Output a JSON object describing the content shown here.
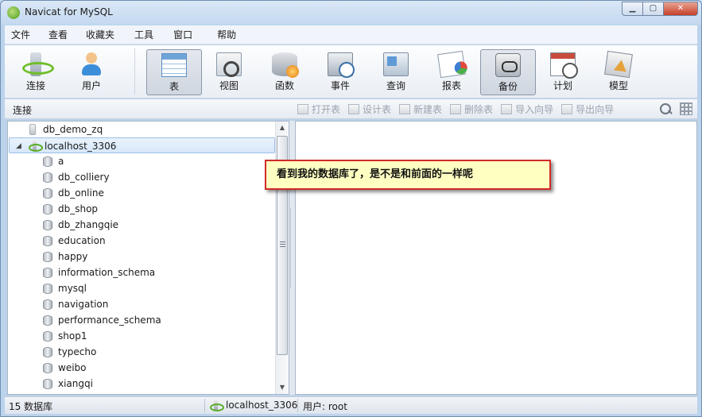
{
  "window": {
    "title": "Navicat for MySQL",
    "controls": {
      "minimize": "▁",
      "maximize": "▢",
      "close": "✕"
    }
  },
  "menu": [
    "文件",
    "查看",
    "收藏夹",
    "工具",
    "窗口",
    "帮助"
  ],
  "toolbar": {
    "buttons": [
      {
        "label": "连接",
        "icon": "connection-icon"
      },
      {
        "label": "用户",
        "icon": "user-icon"
      },
      {
        "label": "表",
        "icon": "table-icon",
        "active": true
      },
      {
        "label": "视图",
        "icon": "view-icon"
      },
      {
        "label": "函数",
        "icon": "function-icon"
      },
      {
        "label": "事件",
        "icon": "event-icon"
      },
      {
        "label": "查询",
        "icon": "query-icon"
      },
      {
        "label": "报表",
        "icon": "report-icon"
      },
      {
        "label": "备份",
        "icon": "backup-icon",
        "active": true
      },
      {
        "label": "计划",
        "icon": "schedule-icon"
      },
      {
        "label": "模型",
        "icon": "model-icon"
      }
    ]
  },
  "subbar": {
    "title": "连接",
    "actions": [
      "打开表",
      "设计表",
      "新建表",
      "删除表",
      "导入向导",
      "导出向导"
    ]
  },
  "tree": {
    "connections": [
      {
        "label": "db_demo_zq",
        "expanded": false,
        "active": false
      },
      {
        "label": "localhost_3306",
        "expanded": true,
        "active": true,
        "selected": true
      }
    ],
    "databases": [
      "a",
      "db_colliery",
      "db_online",
      "db_shop",
      "db_zhangqie",
      "education",
      "happy",
      "information_schema",
      "mysql",
      "navigation",
      "performance_schema",
      "shop1",
      "typecho",
      "weibo",
      "xiangqi"
    ]
  },
  "callout": {
    "text": "看到我的数据库了，是不是和前面的一样呢"
  },
  "status": {
    "count": "15 数据库",
    "connection": "localhost_3306",
    "user": "用户: root"
  }
}
